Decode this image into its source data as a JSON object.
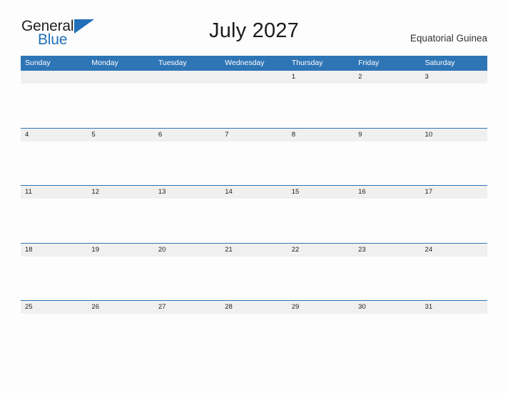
{
  "brand": {
    "name_part1": "General",
    "name_part2": "Blue",
    "triangle_icon": "triangle-icon",
    "color_dark": "#231f20",
    "color_blue": "#2170b8"
  },
  "header": {
    "title": "July 2027",
    "locale": "Equatorial Guinea"
  },
  "calendar": {
    "accent_color": "#2e75b6",
    "band_color": "#f0f0f0",
    "weekdays": [
      "Sunday",
      "Monday",
      "Tuesday",
      "Wednesday",
      "Thursday",
      "Friday",
      "Saturday"
    ],
    "weeks": [
      [
        "",
        "",
        "",
        "",
        "1",
        "2",
        "3"
      ],
      [
        "4",
        "5",
        "6",
        "7",
        "8",
        "9",
        "10"
      ],
      [
        "11",
        "12",
        "13",
        "14",
        "15",
        "16",
        "17"
      ],
      [
        "18",
        "19",
        "20",
        "21",
        "22",
        "23",
        "24"
      ],
      [
        "25",
        "26",
        "27",
        "28",
        "29",
        "30",
        "31"
      ]
    ]
  }
}
